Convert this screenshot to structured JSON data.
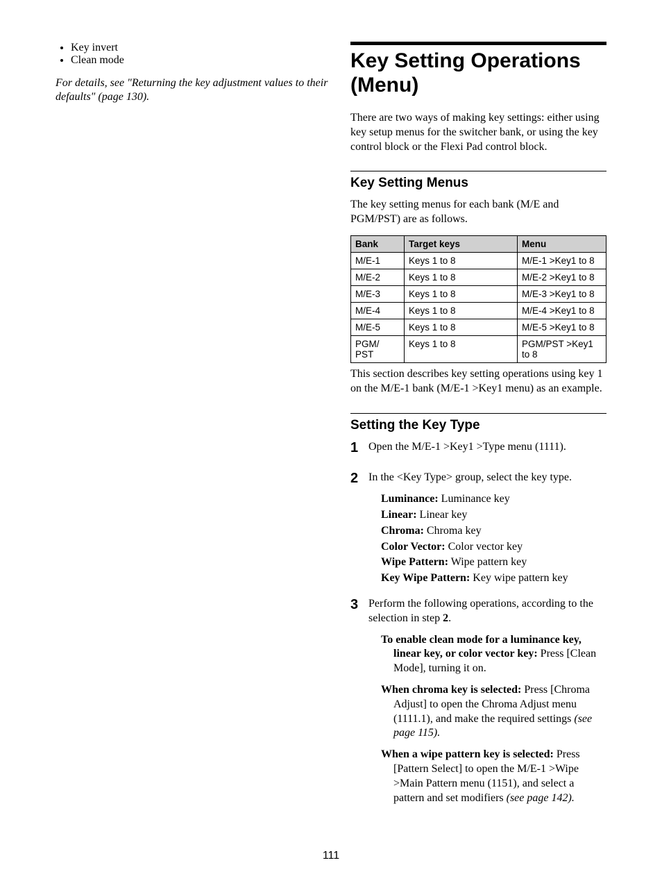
{
  "left": {
    "bullets": [
      "Key invert",
      "Clean mode"
    ],
    "details_ref": "For details, see \"Returning the key adjustment values to their defaults\" (page 130)."
  },
  "right": {
    "main_heading": "Key Setting Operations (Menu)",
    "intro": "There are two ways of making key settings: either using key setup menus for the switcher bank, or using the key control block or the Flexi Pad control block.",
    "section1": {
      "heading": "Key Setting Menus",
      "lead": "The key setting menus for each bank (M/E and PGM/PST) are as follows.",
      "table": {
        "headers": [
          "Bank",
          "Target keys",
          "Menu"
        ],
        "rows": [
          [
            "M/E-1",
            "Keys 1 to 8",
            "M/E-1 >Key1 to 8"
          ],
          [
            "M/E-2",
            "Keys 1 to 8",
            "M/E-2 >Key1 to 8"
          ],
          [
            "M/E-3",
            "Keys 1 to 8",
            "M/E-3 >Key1 to 8"
          ],
          [
            "M/E-4",
            "Keys 1 to 8",
            "M/E-4 >Key1 to 8"
          ],
          [
            "M/E-5",
            "Keys 1 to 8",
            "M/E-5 >Key1 to 8"
          ],
          [
            "PGM/\nPST",
            "Keys 1 to 8",
            "PGM/PST >Key1 to 8"
          ]
        ]
      },
      "after_table": "This section describes key setting operations using key 1 on the M/E-1 bank (M/E-1 >Key1 menu) as an example."
    },
    "section2": {
      "heading": "Setting the Key Type",
      "steps": {
        "s1": "Open the M/E-1 >Key1 >Type menu (1111).",
        "s2_lead": "In the <Key Type> group, select the key type.",
        "s2_items": [
          {
            "label": "Luminance:",
            "desc": " Luminance key"
          },
          {
            "label": "Linear:",
            "desc": " Linear key"
          },
          {
            "label": "Chroma:",
            "desc": " Chroma key"
          },
          {
            "label": "Color Vector:",
            "desc": " Color vector key"
          },
          {
            "label": "Wipe Pattern:",
            "desc": " Wipe pattern key"
          },
          {
            "label": "Key Wipe Pattern:",
            "desc": " Key wipe pattern key"
          }
        ],
        "s3_lead_a": "Perform the following operations, according to the selection in step ",
        "s3_lead_b": "2",
        "s3_lead_c": ".",
        "s3_items": [
          {
            "lead": "To enable clean mode for a luminance key, linear key, or color vector key: ",
            "tail": "Press [Clean Mode], turning it on.",
            "ital": ""
          },
          {
            "lead": "When chroma key is selected: ",
            "tail": "Press [Chroma Adjust] to open the Chroma Adjust menu (1111.1), and make the required settings ",
            "ital": "(see page 115)."
          },
          {
            "lead": "When a wipe pattern key is selected: ",
            "tail": "Press [Pattern Select] to open the M/E-1 >Wipe >Main Pattern menu (1151), and select a pattern and set modifiers ",
            "ital": "(see page 142)."
          }
        ]
      }
    }
  },
  "page_number": "111"
}
